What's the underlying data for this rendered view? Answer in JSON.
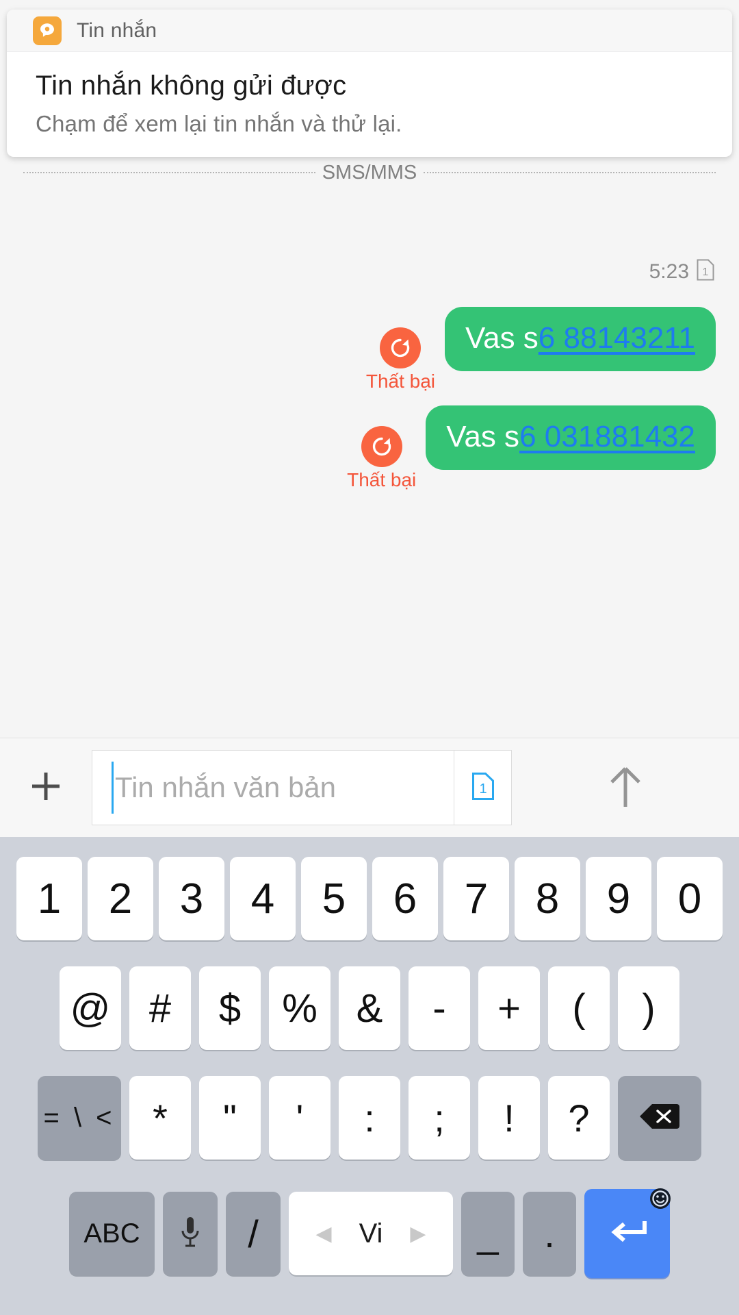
{
  "colors": {
    "bubble_green": "#34C375",
    "link_blue": "#1E7BF0",
    "fail_orange": "#F96440",
    "fail_text": "#F4553A",
    "sim_blue": "#29A8F0",
    "enter_blue": "#4A87F7",
    "keyboard_bg": "#CED2DA",
    "app_icon_orange": "#F5A83C"
  },
  "status_bar": {
    "icons": [
      "notification-bar-orange",
      "notification-bar-blue"
    ]
  },
  "notification": {
    "app_icon": "messages-app-icon",
    "app_name": "Tin nhắn",
    "title": "Tin nhắn không gửi được",
    "body": "Chạm để xem lại tin nhắn và thử lại."
  },
  "conversation": {
    "divider_label": "SMS/MMS",
    "timestamp": "5:23",
    "timestamp_sim": "1",
    "messages": [
      {
        "status_icon": "retry-icon",
        "status_label": "Thất bại",
        "text_plain": "Vas s",
        "text_link": "6 88143211",
        "direction": "outgoing"
      },
      {
        "status_icon": "retry-icon",
        "status_label": "Thất bại",
        "text_plain": "Vas s",
        "text_link": "6 031881432",
        "direction": "outgoing"
      }
    ]
  },
  "input_bar": {
    "attach_icon": "plus-icon",
    "placeholder": "Tin nhắn văn bản",
    "value": "",
    "sim_label": "1",
    "send_icon": "arrow-up-icon"
  },
  "keyboard": {
    "rows": {
      "numbers": [
        "1",
        "2",
        "3",
        "4",
        "5",
        "6",
        "7",
        "8",
        "9",
        "0"
      ],
      "symbols": [
        "@",
        "#",
        "$",
        "%",
        "&",
        "-",
        "+",
        "(",
        ")"
      ],
      "punct_shift": "= \\ <",
      "punct": [
        "*",
        "\"",
        "'",
        ":",
        ";",
        "!",
        "?"
      ],
      "backspace_icon": "backspace-icon",
      "bottom": {
        "abc_label": "ABC",
        "mic_icon": "microphone-icon",
        "slash_label": "/",
        "space_label": "Vi",
        "space_prev_icon": "triangle-left-icon",
        "space_next_icon": "triangle-right-icon",
        "underscore_label": "_",
        "period_label": ".",
        "enter_icon": "return-icon",
        "emoji_badge_icon": "emoji-icon"
      }
    }
  }
}
